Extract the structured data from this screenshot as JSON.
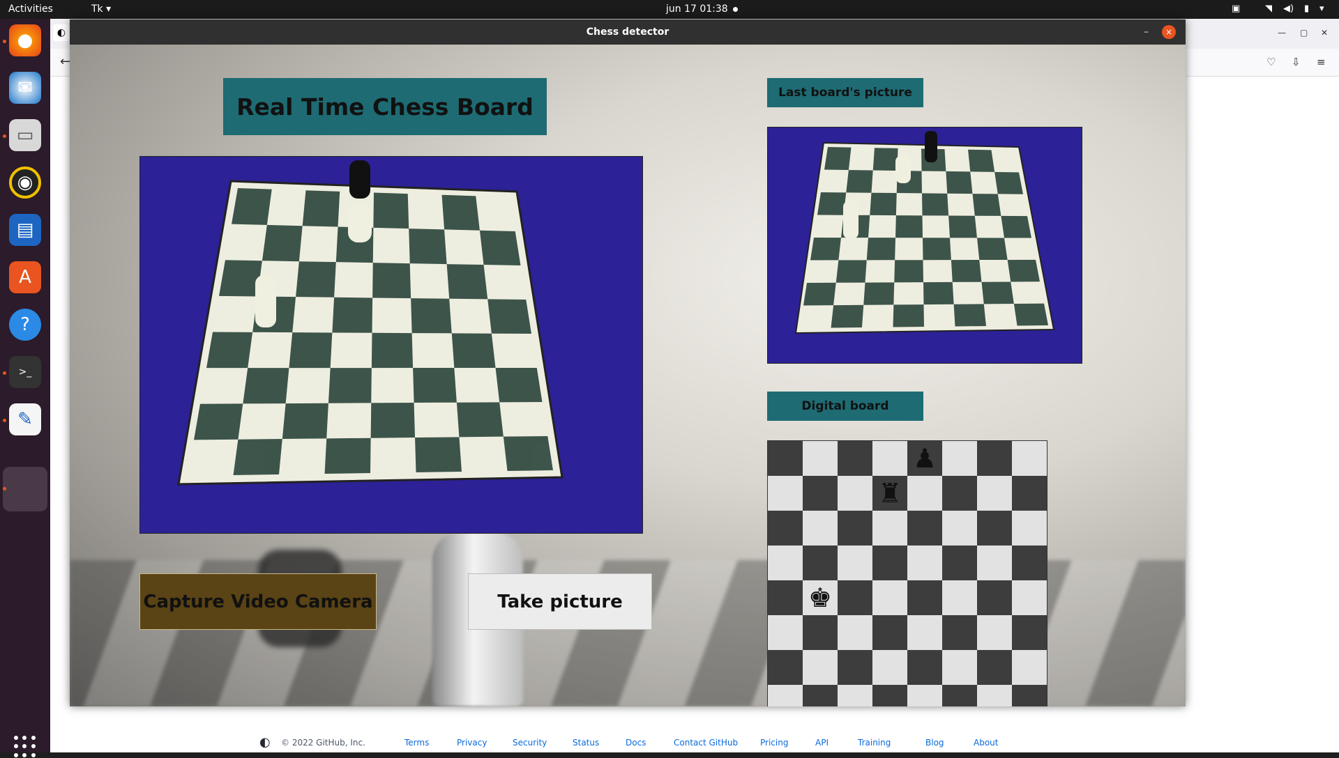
{
  "topbar": {
    "activities": "Activities",
    "app_menu": "Tk ▾",
    "clock": "jun 17  01:38"
  },
  "dock": {
    "apps": [
      "firefox-icon",
      "thunderbird-icon",
      "files-icon",
      "rhythmbox-icon",
      "writer-icon",
      "software-icon",
      "help-icon",
      "terminal-icon",
      "text-editor-icon",
      "tk-app-icon"
    ]
  },
  "window": {
    "title": "Chess detector",
    "minimize": "–",
    "close": "×"
  },
  "app": {
    "header": "Real Time Chess Board",
    "last_picture_label": "Last board's picture",
    "digital_board_label": "Digital board",
    "capture_button": "Capture Video Camera",
    "take_picture_button": "Take picture"
  },
  "digital_board": {
    "rows": [
      [
        "",
        "",
        "",
        "",
        "♟",
        "",
        "",
        ""
      ],
      [
        "",
        "",
        "",
        "♜",
        "",
        "",
        "",
        ""
      ],
      [
        "",
        "",
        "",
        "",
        "",
        "",
        "",
        ""
      ],
      [
        "",
        "",
        "",
        "",
        "",
        "",
        "",
        ""
      ],
      [
        "",
        "♚",
        "",
        "",
        "",
        "",
        "",
        ""
      ],
      [
        "",
        "",
        "",
        "",
        "",
        "",
        "",
        ""
      ],
      [
        "",
        "",
        "",
        "",
        "",
        "",
        "",
        ""
      ],
      [
        "",
        "",
        "",
        "",
        "",
        "",
        "",
        ""
      ]
    ]
  },
  "footer": {
    "copyright": "© 2022 GitHub, Inc.",
    "links": [
      "Terms",
      "Privacy",
      "Security",
      "Status",
      "Docs",
      "Contact GitHub",
      "Pricing",
      "API",
      "Training",
      "Blog",
      "About"
    ]
  },
  "colors": {
    "label_bg": "#1e6b73",
    "capture_bg": "#5a4314",
    "cloth": "#2a1f8f",
    "close_button": "#e95420"
  }
}
